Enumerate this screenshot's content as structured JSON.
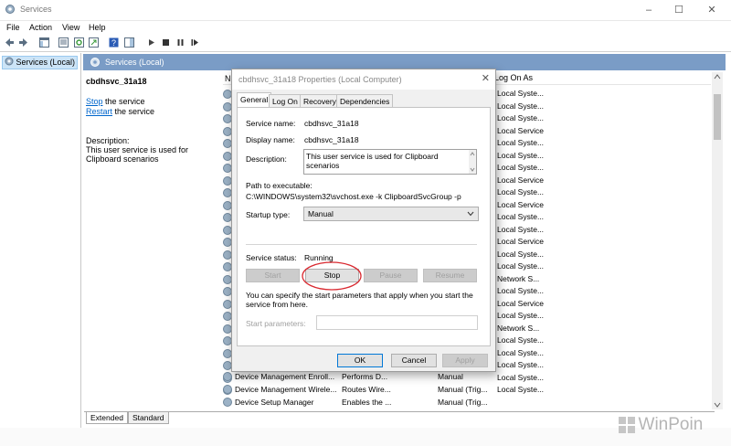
{
  "window": {
    "title": "Services",
    "minimize": "–",
    "maximize": "☐",
    "close": "✕"
  },
  "menu": [
    "File",
    "Action",
    "View",
    "Help"
  ],
  "tree": {
    "item": "Services (Local)"
  },
  "header": {
    "title": "Services (Local)"
  },
  "detail": {
    "name": "cbdhsvc_31a18",
    "stop_link": "Stop",
    "stop_rest": " the service",
    "restart_link": "Restart",
    "restart_rest": " the service",
    "description_label": "Description:",
    "description_text": "This user service is used for Clipboard scenarios"
  },
  "column_header": "Log On As",
  "logon_values": [
    "Local Syste...",
    "Local Syste...",
    "Local Syste...",
    "Local Service",
    "Local Syste...",
    "Local Syste...",
    "Local Syste...",
    "Local Service",
    "Local Syste...",
    "Local Service",
    "Local Syste...",
    "Local Syste...",
    "Local Service",
    "Local Syste...",
    "Local Syste...",
    "Network S...",
    "Local Syste...",
    "Local Service",
    "Local Syste...",
    "Network S...",
    "Local Syste...",
    "Local Syste...",
    "Local Syste...",
    "Local Syste...",
    "Local Syste..."
  ],
  "visible_rows": [
    {
      "name": "Device Management Enroll...",
      "desc": "Performs D...",
      "startup": "Manual"
    },
    {
      "name": "Device Management Wirele...",
      "desc": "Routes Wire...",
      "startup": "Manual (Trig..."
    },
    {
      "name": "Device Setup Manager",
      "desc": "Enables the ...",
      "startup": "Manual (Trig..."
    }
  ],
  "bottom_tabs": [
    "Extended",
    "Standard"
  ],
  "dialog": {
    "title": "cbdhsvc_31a18 Properties (Local Computer)",
    "tabs": [
      "General",
      "Log On",
      "Recovery",
      "Dependencies"
    ],
    "service_name_label": "Service name:",
    "service_name": "cbdhsvc_31a18",
    "display_name_label": "Display name:",
    "display_name": "cbdhsvc_31a18",
    "description_label": "Description:",
    "description": "This user service is used for Clipboard scenarios",
    "path_label": "Path to executable:",
    "path": "C:\\WINDOWS\\system32\\svchost.exe -k ClipboardSvcGroup -p",
    "startup_label": "Startup type:",
    "startup_value": "Manual",
    "status_label": "Service status:",
    "status_value": "Running",
    "btn_start": "Start",
    "btn_stop": "Stop",
    "btn_pause": "Pause",
    "btn_resume": "Resume",
    "hint": "You can specify the start parameters that apply when you start the service from here.",
    "params_label": "Start parameters:",
    "params_value": "",
    "ok": "OK",
    "cancel": "Cancel",
    "apply": "Apply"
  },
  "watermark": "WinPoin",
  "colors": {
    "header": "#7a9cc6",
    "link": "#0066cc",
    "highlight_circle": "#d9282f"
  }
}
